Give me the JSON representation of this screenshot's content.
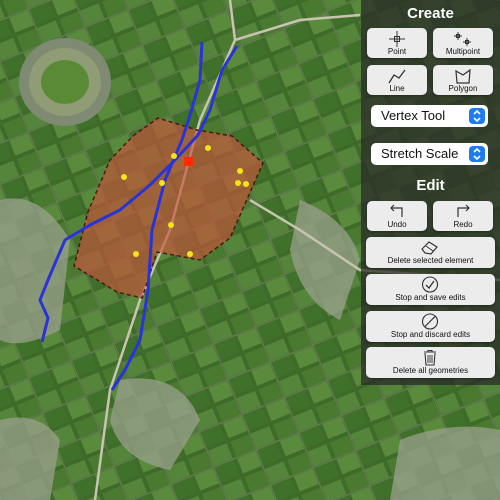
{
  "map": {
    "basemap": "satellite-imagery",
    "polygon_fill": "#c8543a",
    "polyline_color": "#2a33d8",
    "point_color": "#f5e416",
    "selected_vertex_color": "#ff2a00"
  },
  "panel": {
    "create_title": "Create",
    "edit_title": "Edit",
    "create_tools": [
      {
        "label": "Point",
        "icon": "point-crosshair-icon"
      },
      {
        "label": "Multipoint",
        "icon": "multipoint-icon"
      },
      {
        "label": "Line",
        "icon": "polyline-icon"
      },
      {
        "label": "Polygon",
        "icon": "polygon-icon"
      }
    ],
    "tool_select": {
      "value": "Vertex Tool"
    },
    "scale_select": {
      "value": "Stretch Scale"
    },
    "undo_label": "Undo",
    "redo_label": "Redo",
    "actions": [
      {
        "label": "Delete selected element",
        "icon": "eraser-icon"
      },
      {
        "label": "Stop and save edits",
        "icon": "checkmark-circle-icon"
      },
      {
        "label": "Stop and discard edits",
        "icon": "no-circle-icon"
      },
      {
        "label": "Delete all geometries",
        "icon": "trash-icon"
      }
    ]
  }
}
